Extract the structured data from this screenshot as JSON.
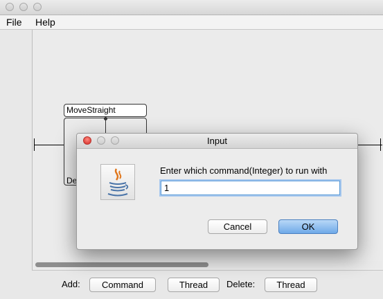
{
  "menubar": {
    "file": "File",
    "help": "Help"
  },
  "canvas": {
    "node_title": "MoveStraight",
    "node_partial_text": "De"
  },
  "bottom": {
    "add_label": "Add:",
    "command_button": "Command",
    "thread_button": "Thread",
    "delete_label": "Delete:",
    "delete_thread_button": "Thread"
  },
  "dialog": {
    "title": "Input",
    "prompt": "Enter which command(Integer) to run with",
    "input_value": "1",
    "cancel": "Cancel",
    "ok": "OK"
  },
  "icons": {
    "dialog_icon": "java-coffee-cup-icon"
  }
}
